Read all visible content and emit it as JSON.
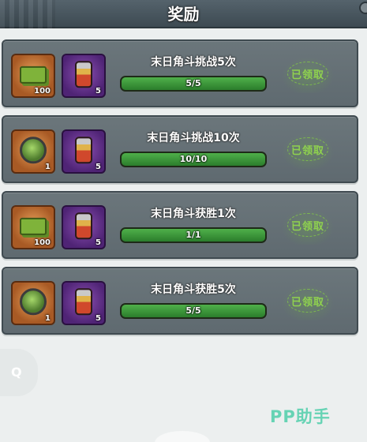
{
  "header": {
    "title": "奖励"
  },
  "tasks": [
    {
      "name": "末日角斗挑战5次",
      "progress_text": "5/5",
      "progress": 1.0,
      "status": "已领取",
      "rewards": [
        {
          "icon": "cash-bundle-icon",
          "qty": "100"
        },
        {
          "icon": "potion-bottle-icon",
          "qty": "5"
        }
      ]
    },
    {
      "name": "末日角斗挑战10次",
      "progress_text": "10/10",
      "progress": 1.0,
      "status": "已领取",
      "rewards": [
        {
          "icon": "green-orb-icon",
          "qty": "1"
        },
        {
          "icon": "potion-bottle-icon",
          "qty": "5"
        }
      ]
    },
    {
      "name": "末日角斗获胜1次",
      "progress_text": "1/1",
      "progress": 1.0,
      "status": "已领取",
      "rewards": [
        {
          "icon": "cash-bundle-icon",
          "qty": "100"
        },
        {
          "icon": "potion-bottle-icon",
          "qty": "5"
        }
      ]
    },
    {
      "name": "末日角斗获胜5次",
      "progress_text": "5/5",
      "progress": 1.0,
      "status": "已领取",
      "rewards": [
        {
          "icon": "green-orb-icon",
          "qty": "1"
        },
        {
          "icon": "potion-bottle-icon",
          "qty": "5"
        }
      ]
    }
  ],
  "floating": {
    "search_glyph": "Q"
  },
  "watermark": "PP助手"
}
